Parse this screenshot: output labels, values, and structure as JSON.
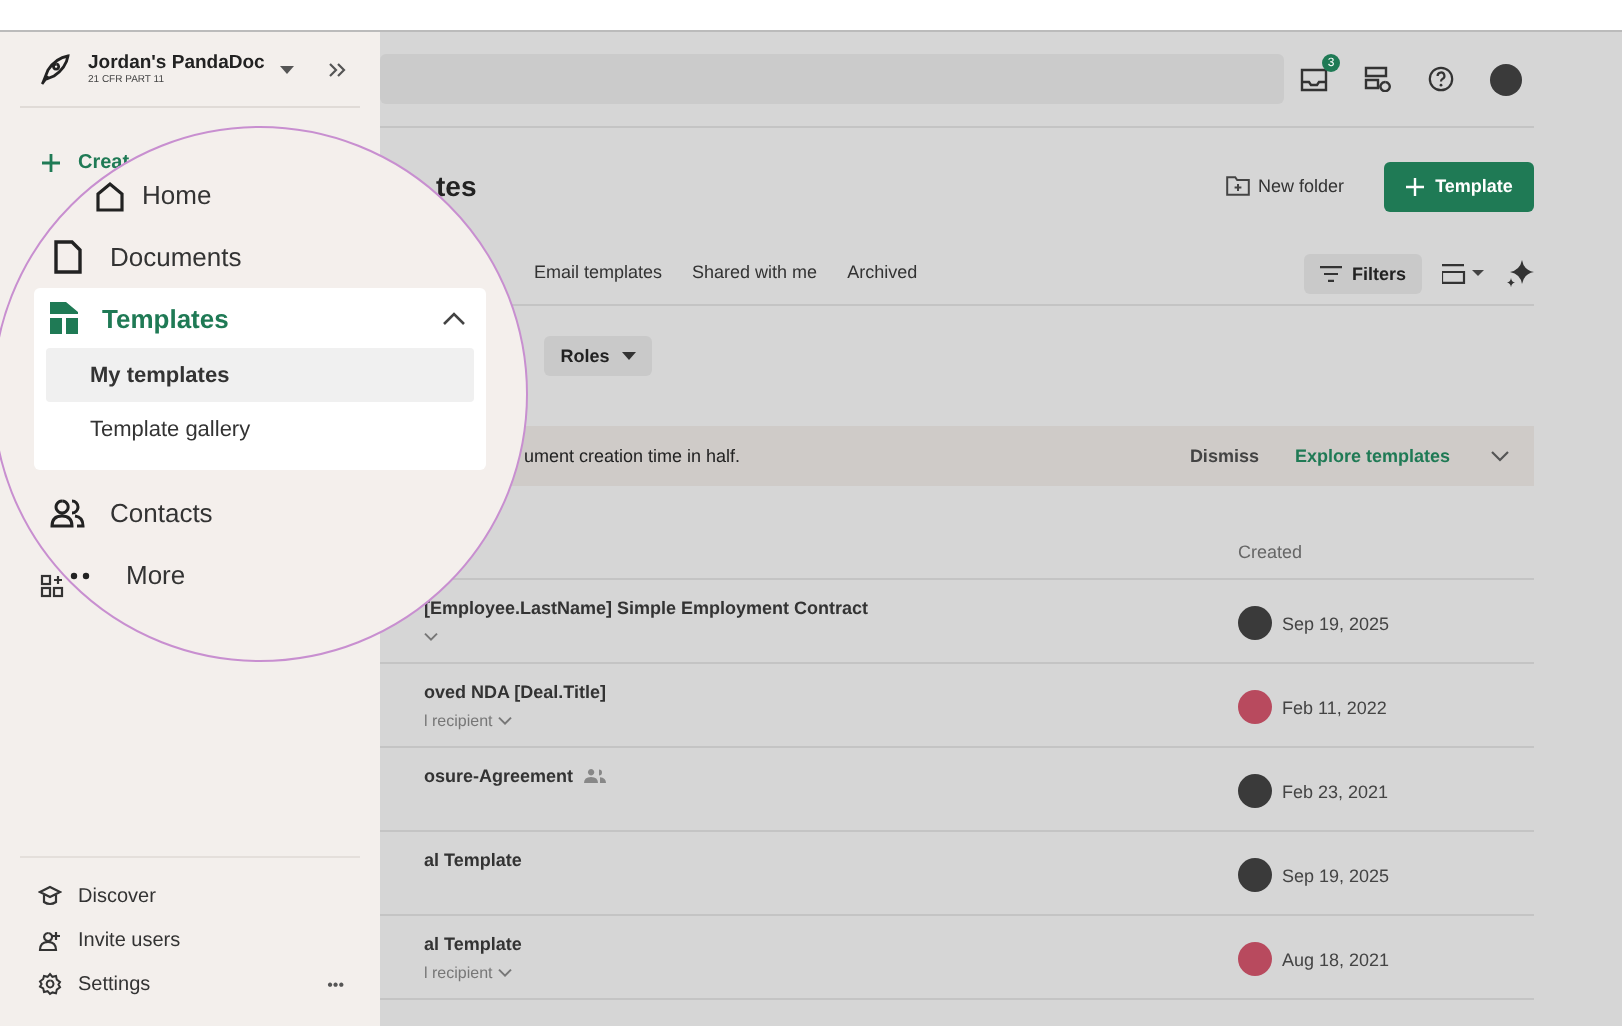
{
  "sidebar": {
    "workspace": {
      "name": "Jordan's PandaDoc",
      "subtitle": "21 CFR PART 11"
    },
    "create_label": "Creat",
    "footer_items": [
      {
        "kind": "discover",
        "label": "Discover"
      },
      {
        "kind": "invite",
        "label": "Invite users"
      },
      {
        "kind": "settings",
        "label": "Settings"
      }
    ],
    "more_label": "•••"
  },
  "magnifier": {
    "items": [
      {
        "kind": "home",
        "label": "Home",
        "selected": false
      },
      {
        "kind": "documents",
        "label": "Documents",
        "selected": false
      },
      {
        "kind": "templates",
        "label": "Templates",
        "selected": true,
        "expanded": true,
        "children": [
          {
            "label": "My templates",
            "selected": true
          },
          {
            "label": "Template gallery",
            "selected": false
          }
        ]
      },
      {
        "kind": "contacts",
        "label": "Contacts",
        "selected": false
      },
      {
        "kind": "more",
        "label": "More",
        "selected": false
      }
    ]
  },
  "topbar": {
    "notification_count": "3"
  },
  "header": {
    "title": "tes",
    "new_folder": "New folder",
    "primary_button": "Template"
  },
  "tabs": [
    {
      "label": "Email templates",
      "selected": false
    },
    {
      "label": "Shared with me",
      "selected": false
    },
    {
      "label": "Archived",
      "selected": false
    }
  ],
  "toolbar": {
    "filters": "Filters",
    "roles": "Roles"
  },
  "banner": {
    "text": "ument creation time in half.",
    "dismiss": "Dismiss",
    "explore": "Explore templates"
  },
  "table": {
    "created_header": "Created",
    "rows": [
      {
        "title": "[Employee.LastName] Simple Employment Contract",
        "dropdown": true,
        "shared": false,
        "created": "Sep 19, 2025",
        "color": "#3a3a3a"
      },
      {
        "title": "oved NDA  [Deal.Title]",
        "subtitle": "l recipient",
        "dropdown": true,
        "shared": false,
        "created": "Feb 11, 2022",
        "color": "#b84a5e"
      },
      {
        "title": "osure-Agreement",
        "dropdown": false,
        "shared": true,
        "created": "Feb 23, 2021",
        "color": "#3a3a3a"
      },
      {
        "title": "al Template",
        "dropdown": false,
        "shared": false,
        "created": "Sep 19, 2025",
        "color": "#3a3a3a"
      },
      {
        "title": "al Template",
        "subtitle": "l recipient",
        "dropdown": true,
        "shared": false,
        "created": "Aug 18, 2021",
        "color": "#b84a5e"
      }
    ]
  }
}
